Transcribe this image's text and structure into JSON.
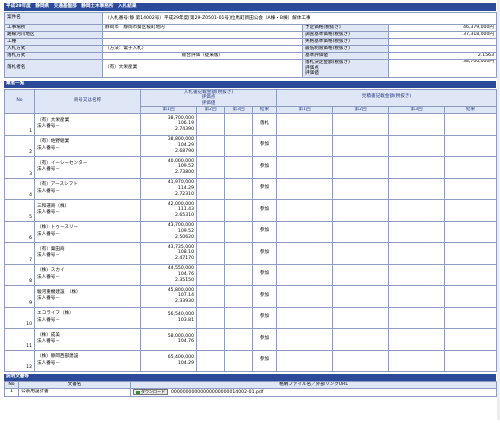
{
  "header": {
    "title": "平成29年度　静岡県　交通基盤部　静岡土木事務所　入札結果"
  },
  "info": {
    "rows": [
      {
        "label": "案件名",
        "value": "（入札番号:静 第14002号）平成29年度[第29-Z0501-01号]位馬町新田公会（A棟・B棟）解体工事",
        "rlabel": "",
        "rvalue": ""
      },
      {
        "label": "工事場所",
        "value": "静岡市　静岡市葵区桜町地内",
        "rlabel": "予定価格(税抜き)",
        "rvalue": "46,379,000円"
      },
      {
        "label": "路線河川地区",
        "value": "",
        "rlabel": "調査基準価格(税抜き)",
        "rvalue": "37,318,000円"
      },
      {
        "label": "工種",
        "value": "",
        "rlabel": "失格基準価格(税抜き)",
        "rvalue": ""
      },
      {
        "label": "入札方式",
        "value": "（方法：電子入札）",
        "rlabel": "最低制限価格(税抜き)",
        "rvalue": ""
      },
      {
        "label": "落札方式",
        "value": "総合評価（従来版）",
        "rlabel": "基準評価値",
        "rvalue": "2.1563"
      },
      {
        "label": "落札者名",
        "value": "（有）大栄産業",
        "rlabel": "落札決定金額(税抜き)\n評価点\n評価値",
        "rvalue": "38,700,000円"
      }
    ]
  },
  "bidders": {
    "section_title": "業者一覧",
    "col_no": "No",
    "col_name": "商号又は名称",
    "group1": "入札書記載金額(税抜き)\n評価点\n評価値",
    "group2": "見積書記載金額(税抜き)",
    "col_r1": "第1回",
    "col_r2": "第2回",
    "col_result": "結果",
    "col_r3": "第3回",
    "rows": [
      {
        "no": "1",
        "name": "（有）大栄産業",
        "rep": "法人番号－",
        "amount": "38,700,000",
        "score": "106.19",
        "value": "2.74390",
        "result": "落札"
      },
      {
        "no": "2",
        "name": "（有）佐野組業",
        "rep": "法人番号－",
        "amount": "38,800,000",
        "score": "104.29",
        "value": "2.68790",
        "result": "参加"
      },
      {
        "no": "3",
        "name": "（有）イーシーセンター",
        "rep": "法人番号－",
        "amount": "40,000,000",
        "score": "109.52",
        "value": "2.73800",
        "result": "参加"
      },
      {
        "no": "4",
        "name": "（有）アースシフト",
        "rep": "法人番号－",
        "amount": "41,970,000",
        "score": "114.29",
        "value": "2.72310",
        "result": "参加"
      },
      {
        "no": "5",
        "name": "三和運商（株）",
        "rep": "法人番号－",
        "amount": "42,000,000",
        "score": "111.43",
        "value": "2.65310",
        "result": "参加"
      },
      {
        "no": "6",
        "name": "（株）トゥースリー",
        "rep": "法人番号－",
        "amount": "43,700,000",
        "score": "109.52",
        "value": "2.50620",
        "result": "参加"
      },
      {
        "no": "7",
        "name": "（有）粟田商",
        "rep": "法人番号－",
        "amount": "43,735,000",
        "score": "108.10",
        "value": "2.47170",
        "result": "参加"
      },
      {
        "no": "8",
        "name": "（株）スカイ",
        "rep": "法人番号－",
        "amount": "44,550,000",
        "score": "104.76",
        "value": "2.35150",
        "result": "参加"
      },
      {
        "no": "9",
        "name": "駿河重機建設　（株）",
        "rep": "法人番号－",
        "amount": "45,800,000",
        "score": "107.14",
        "value": "2.33930",
        "result": "参加"
      },
      {
        "no": "10",
        "name": "エコライフ（株）",
        "rep": "法人番号－",
        "amount": "56,540,000",
        "score": "103.81",
        "value": "",
        "result": "参加"
      },
      {
        "no": "11",
        "name": "（株）成美",
        "rep": "法人番号－",
        "amount": "58,000,000",
        "score": "104.76",
        "value": "",
        "result": "参加"
      },
      {
        "no": "12",
        "name": "（株）静岡西部建設",
        "rep": "法人番号－",
        "amount": "65,400,000",
        "score": "104.29",
        "value": "",
        "result": "参加"
      }
    ]
  },
  "docs": {
    "section_title": "説明文書等",
    "col_no": "No",
    "col_doc": "文書名",
    "col_file": "格納ファイル名／外部リンクURL",
    "rows": [
      {
        "no": "1",
        "name": "公表用設計書",
        "button": "ダウンロード",
        "file": "00000000000000000000014002-01.pdf"
      }
    ]
  }
}
